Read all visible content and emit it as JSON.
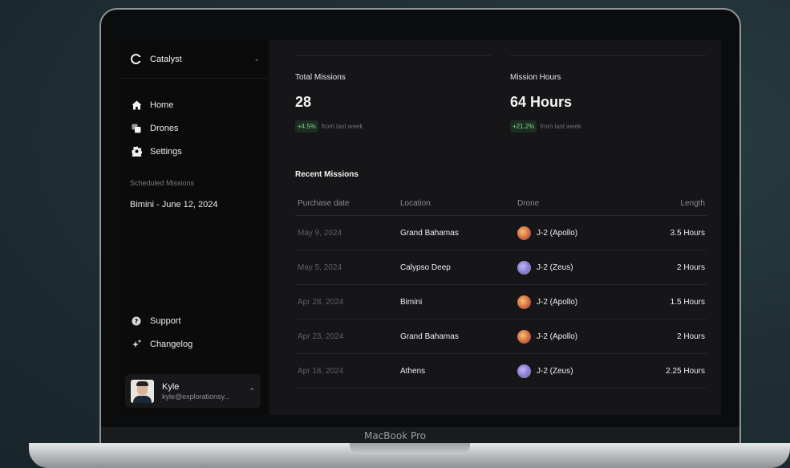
{
  "device": {
    "model_label": "MacBook Pro"
  },
  "sidebar": {
    "brand": {
      "name": "Catalyst",
      "chevron": "⌄"
    },
    "nav": [
      {
        "label": "Home",
        "icon": "home-icon"
      },
      {
        "label": "Drones",
        "icon": "squares-icon"
      },
      {
        "label": "Settings",
        "icon": "gear-icon"
      }
    ],
    "scheduled_label": "Scheduled Missions",
    "scheduled_items": [
      "Bimini - June 12, 2024"
    ],
    "bottom_nav": [
      {
        "label": "Support",
        "icon": "question-icon"
      },
      {
        "label": "Changelog",
        "icon": "sparkle-icon"
      }
    ],
    "user": {
      "name": "Kyle",
      "email": "kyle@explorationsy...",
      "chevron": "⌃"
    }
  },
  "stats": [
    {
      "label": "Total Missions",
      "value": "28",
      "change": "+4.5%",
      "note": "from last week"
    },
    {
      "label": "Mission Hours",
      "value": "64 Hours",
      "change": "+21.2%",
      "note": "from last week"
    }
  ],
  "recent": {
    "title": "Recent Missions",
    "columns": [
      "Purchase date",
      "Location",
      "Drone",
      "Length"
    ],
    "rows": [
      {
        "date": "May 9, 2024",
        "location": "Grand Bahamas",
        "drone": "J-2 (Apollo)",
        "drone_type": "apollo",
        "length": "3.5 Hours"
      },
      {
        "date": "May 5, 2024",
        "location": "Calypso Deep",
        "drone": "J-2 (Zeus)",
        "drone_type": "zeus",
        "length": "2 Hours"
      },
      {
        "date": "Apr 28, 2024",
        "location": "Bimini",
        "drone": "J-2 (Apollo)",
        "drone_type": "apollo",
        "length": "1.5 Hours"
      },
      {
        "date": "Apr 23, 2024",
        "location": "Grand Bahamas",
        "drone": "J-2 (Apollo)",
        "drone_type": "apollo",
        "length": "2 Hours"
      },
      {
        "date": "Apr 18, 2024",
        "location": "Athens",
        "drone": "J-2 (Zeus)",
        "drone_type": "zeus",
        "length": "2.25 Hours"
      }
    ]
  },
  "colors": {
    "positive": "#7fd38f",
    "background": "#161618"
  }
}
